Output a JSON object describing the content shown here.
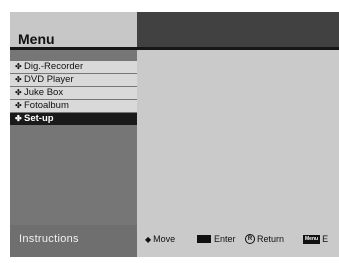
{
  "header": {
    "title": "Menu"
  },
  "menu": {
    "items": [
      {
        "label": "Dig.-Recorder",
        "bullet": "✤",
        "selected": false
      },
      {
        "label": "DVD Player",
        "bullet": "✤",
        "selected": false
      },
      {
        "label": "Juke Box",
        "bullet": "✤",
        "selected": false
      },
      {
        "label": "Fotoalbum",
        "bullet": "✤",
        "selected": false
      },
      {
        "label": "Set-up",
        "bullet": "✤",
        "selected": true
      }
    ]
  },
  "footer": {
    "label": "Instructions",
    "hints": {
      "move": {
        "icon": "◆",
        "label": "Move"
      },
      "enter": {
        "label": "Enter"
      },
      "return": {
        "icon": "R",
        "label": "Return"
      },
      "menu": {
        "key": "Menu",
        "label": "E"
      }
    }
  }
}
